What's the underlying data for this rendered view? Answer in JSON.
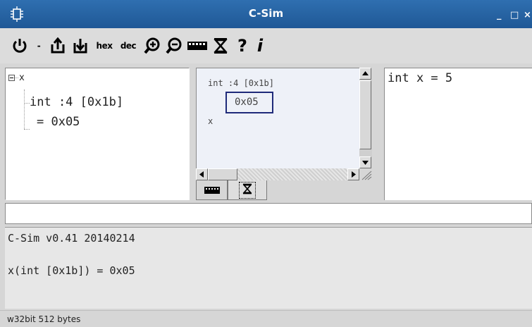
{
  "window": {
    "title": "C-Sim",
    "icon": "chip-icon",
    "minimize_label": "_",
    "maximize_label": "□",
    "close_label": "×"
  },
  "toolbar": {
    "items": [
      {
        "icon": "power-icon"
      },
      {
        "label": "-"
      },
      {
        "icon": "upload-icon"
      },
      {
        "icon": "download-icon"
      },
      {
        "label": "hex"
      },
      {
        "label": "dec"
      },
      {
        "icon": "zoom-in-icon"
      },
      {
        "icon": "zoom-out-icon"
      },
      {
        "icon": "memory-icon"
      },
      {
        "icon": "hourglass-icon"
      },
      {
        "label": "?"
      },
      {
        "label": "i"
      }
    ]
  },
  "tree": {
    "root_label": "x",
    "type_label": "int :4 [0x1b]",
    "value_label": "= 0x05"
  },
  "view": {
    "type_label": "int :4 [0x1b]",
    "value_label": "0x05",
    "name_label": "x",
    "tabs": [
      {
        "icon": "memory-icon"
      },
      {
        "icon": "hourglass-icon",
        "selected": true
      }
    ]
  },
  "code": {
    "line1": "int x = 5"
  },
  "command": {
    "value": ""
  },
  "console": {
    "line1": "C-Sim v0.41 20140214",
    "line2": "x(int [0x1b]) = 0x05"
  },
  "status": {
    "text": "w32bit 512 bytes"
  }
}
